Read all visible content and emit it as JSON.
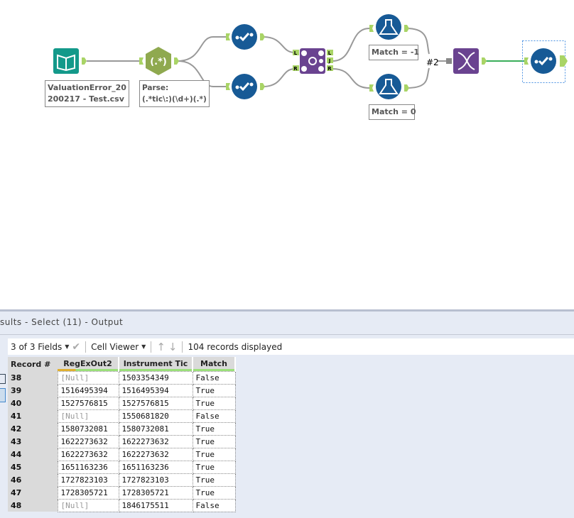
{
  "workflow": {
    "input_label": [
      "ValuationError_20",
      "200217 - Test.csv"
    ],
    "regex_label": [
      "Parse:",
      "(.*tic\\:)(\\d+)(.*)"
    ],
    "regex_glyph": "(.*)",
    "join_anchors": {
      "left": "L",
      "right": "R",
      "out_left": "L",
      "out_join": "J",
      "out_right": "R"
    },
    "filter_top_label": "Match = -1",
    "filter_bottom_label": "Match = 0",
    "union_connection": "#2",
    "colors": {
      "input": "#13998a",
      "regex": "#8fa94f",
      "select": "#175a96",
      "join": "#6a4390",
      "anchor": "#a9d466",
      "connection_active": "#3aae5a"
    }
  },
  "results": {
    "title": "sults - Select (11) - Output",
    "fields_dropdown": "3 of 3 Fields",
    "cell_viewer": "Cell Viewer",
    "records_displayed": "104 records displayed",
    "columns": [
      "Record #",
      "RegExOut2",
      "Instrument Tic",
      "Match"
    ],
    "rows": [
      [
        "38",
        "[Null]",
        "1503354349",
        "False"
      ],
      [
        "39",
        "1516495394",
        "1516495394",
        "True"
      ],
      [
        "40",
        "1527576815",
        "1527576815",
        "True"
      ],
      [
        "41",
        "[Null]",
        "1550681820",
        "False"
      ],
      [
        "42",
        "1580732081",
        "1580732081",
        "True"
      ],
      [
        "43",
        "1622273632",
        "1622273632",
        "True"
      ],
      [
        "44",
        "1622273632",
        "1622273632",
        "True"
      ],
      [
        "45",
        "1651163236",
        "1651163236",
        "True"
      ],
      [
        "46",
        "1727823103",
        "1727823103",
        "True"
      ],
      [
        "47",
        "1728305721",
        "1728305721",
        "True"
      ],
      [
        "48",
        "[Null]",
        "1846175511",
        "False"
      ]
    ]
  }
}
